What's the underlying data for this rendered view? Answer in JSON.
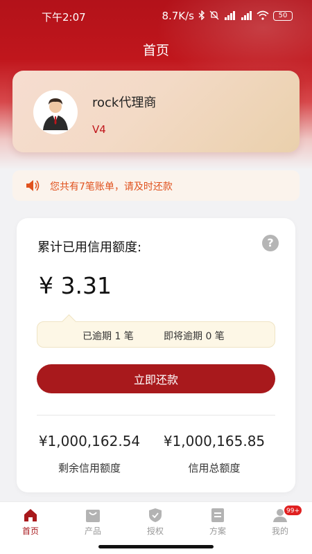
{
  "status_bar": {
    "time": "下午2:07",
    "network_speed": "8.7K/s",
    "battery": "50",
    "icons": [
      "bluetooth-icon",
      "mute-icon",
      "signal-icon",
      "signal-icon",
      "wifi-icon",
      "battery-icon"
    ]
  },
  "header": {
    "title": "首页"
  },
  "profile": {
    "name": "rock代理商",
    "level": "V4",
    "avatar": "user-avatar-icon"
  },
  "notice": {
    "text": "您共有7笔账单，请及时还款",
    "icon": "speaker-icon"
  },
  "credit": {
    "title": "累计已用信用额度:",
    "help_icon": "help-icon",
    "help_symbol": "?",
    "amount": "¥ 3.31",
    "overdue": "已逾期 1 笔",
    "upcoming": "即将逾期 0 笔",
    "repay_label": "立即还款",
    "remaining_value": "¥1,000,162.54",
    "remaining_label": "剩余信用额度",
    "total_value": "¥1,000,165.85",
    "total_label": "信用总额度"
  },
  "tabbar": {
    "items": [
      {
        "label": "首页",
        "icon": "home-icon",
        "active": true
      },
      {
        "label": "产品",
        "icon": "bag-icon",
        "active": false
      },
      {
        "label": "授权",
        "icon": "shield-icon",
        "active": false
      },
      {
        "label": "方案",
        "icon": "document-icon",
        "active": false
      },
      {
        "label": "我的",
        "icon": "user-icon",
        "active": false,
        "badge": "99+"
      }
    ]
  },
  "colors": {
    "brand": "#a8191c",
    "notice": "#e0521e",
    "level": "#c0161c"
  }
}
